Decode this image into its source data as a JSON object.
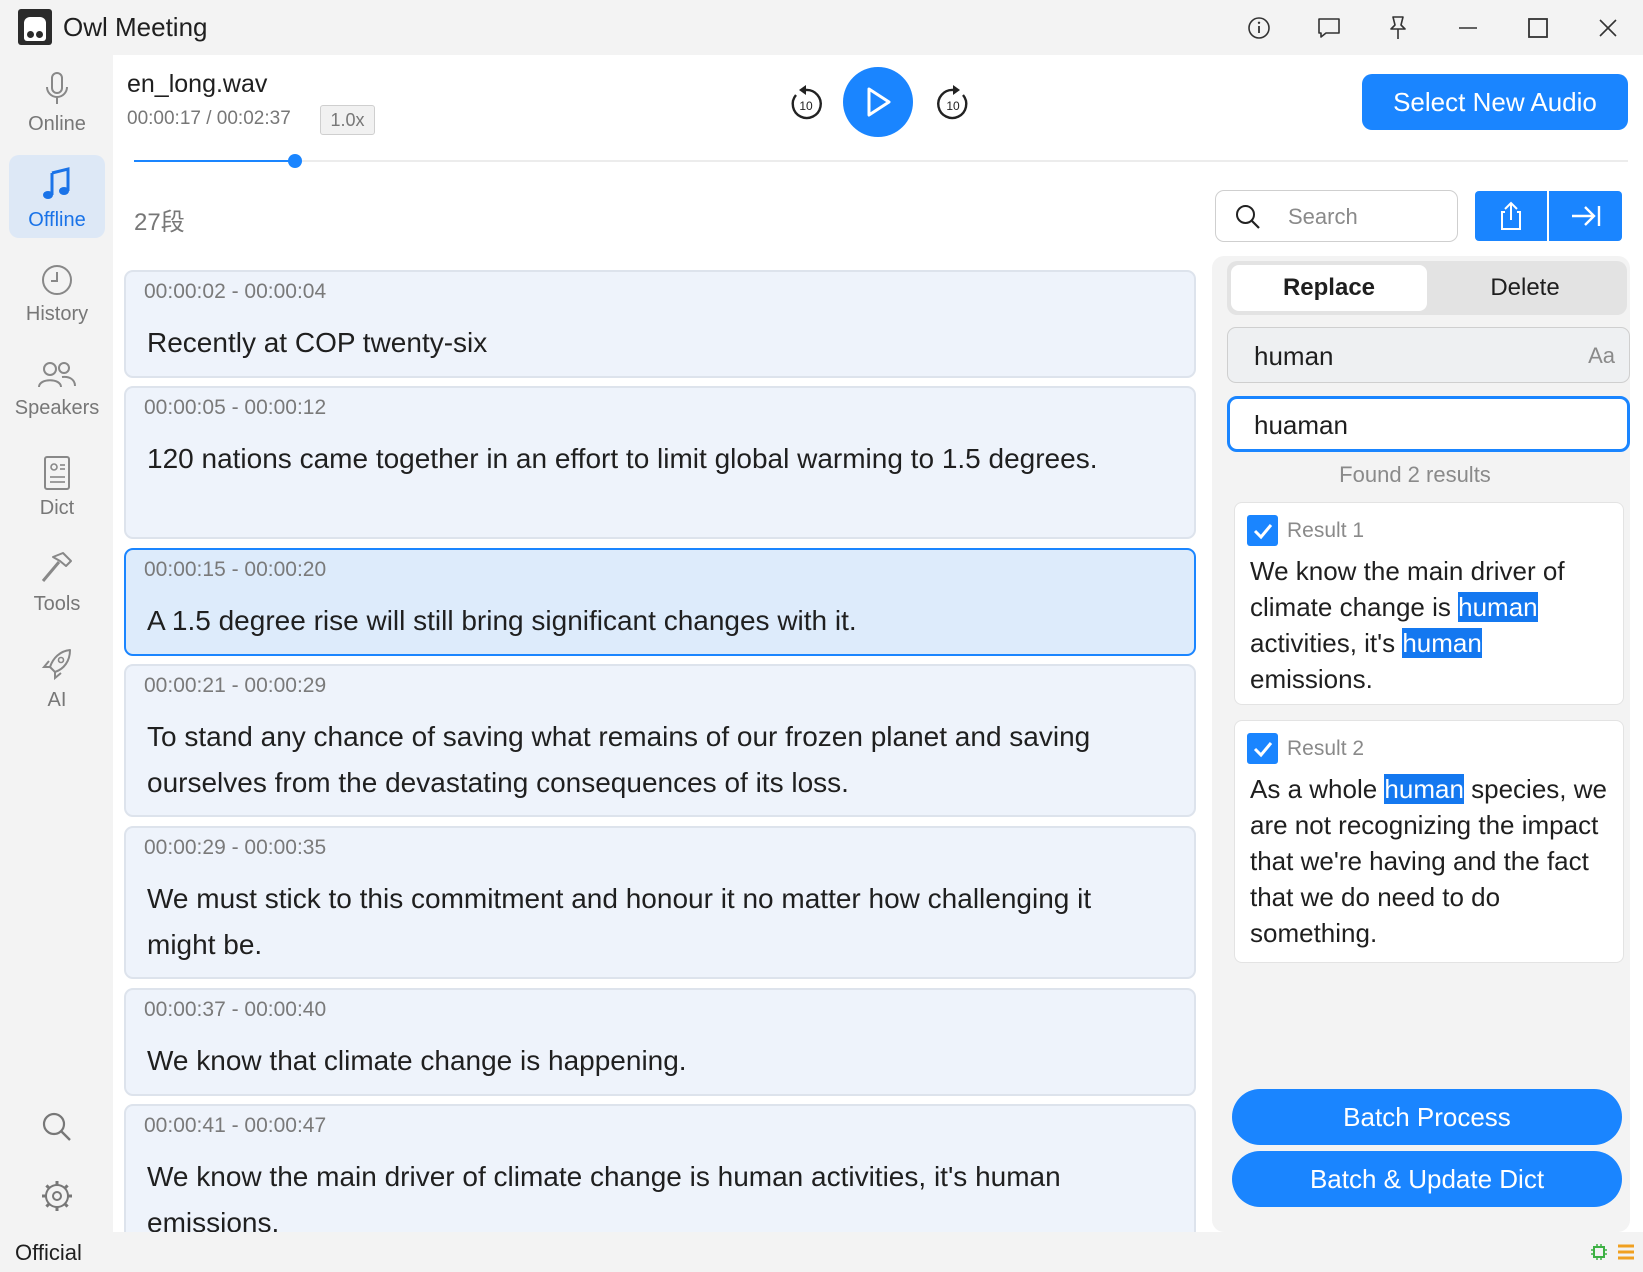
{
  "window": {
    "title": "Owl Meeting",
    "icons": [
      "info-icon",
      "feedback-icon",
      "pin-icon",
      "minimize-icon",
      "maximize-icon",
      "close-icon"
    ]
  },
  "nav": {
    "items": [
      {
        "label": "Online",
        "icon": "microphone-icon",
        "active": false
      },
      {
        "label": "Offline",
        "icon": "music-note-icon",
        "active": true
      },
      {
        "label": "History",
        "icon": "clock-icon",
        "active": false
      },
      {
        "label": "Speakers",
        "icon": "people-icon",
        "active": false
      },
      {
        "label": "Dict",
        "icon": "dictionary-icon",
        "active": false
      },
      {
        "label": "Tools",
        "icon": "hammer-icon",
        "active": false
      },
      {
        "label": "AI",
        "icon": "rocket-icon",
        "active": false
      }
    ]
  },
  "player": {
    "filename": "en_long.wav",
    "time": "00:00:17 / 00:02:37",
    "speed": "1.0x",
    "skip_back": "10",
    "skip_forward": "10",
    "progress_fraction": 0.108,
    "select_label": "Select New Audio"
  },
  "transcript": {
    "count_label": "27段",
    "segments": [
      {
        "time": "00:00:02 - 00:00:04",
        "text": "Recently at COP twenty-six",
        "active": false
      },
      {
        "time": "00:00:05 - 00:00:12",
        "text": "120 nations came together in an effort to limit global warming to 1.5 degrees.",
        "active": false
      },
      {
        "time": "00:00:15 - 00:00:20",
        "text": "A 1.5 degree rise will still bring significant changes with it.",
        "active": true
      },
      {
        "time": "00:00:21 - 00:00:29",
        "text": "To stand any chance of saving what remains of our frozen planet and saving ourselves from the devastating consequences of its loss.",
        "active": false
      },
      {
        "time": "00:00:29 - 00:00:35",
        "text": "We must stick to this commitment and honour it no matter how challenging it might be.",
        "active": false
      },
      {
        "time": "00:00:37 - 00:00:40",
        "text": "We know that climate change is happening.",
        "active": false
      },
      {
        "time": "00:00:41 - 00:00:47",
        "text": "We know the main driver of climate change is human activities, it's human emissions.",
        "active": false
      }
    ]
  },
  "search": {
    "placeholder": "Search"
  },
  "replace_panel": {
    "tabs": [
      "Replace",
      "Delete"
    ],
    "selected_tab": "Replace",
    "find_value": "human",
    "match_case_label": "Aa",
    "replace_value": "huaman",
    "found_text": "Found 2 results",
    "results": [
      {
        "title": "Result 1",
        "checked": true,
        "parts": [
          {
            "t": "We know the main driver of climate change is ",
            "h": false
          },
          {
            "t": "human",
            "h": true
          },
          {
            "t": " activities, it's ",
            "h": false
          },
          {
            "t": "human",
            "h": true
          },
          {
            "t": " emissions.",
            "h": false
          }
        ]
      },
      {
        "title": "Result 2",
        "checked": true,
        "parts": [
          {
            "t": "As a whole ",
            "h": false
          },
          {
            "t": "human",
            "h": true
          },
          {
            "t": " species, we are not recognizing the impact that we're having and the fact that we do need to do something.",
            "h": false
          }
        ]
      }
    ],
    "batch_process_label": "Batch Process",
    "batch_update_label": "Batch & Update Dict"
  },
  "status": {
    "text": "Official"
  },
  "colors": {
    "accent": "#1a85ff",
    "highlight": "#1478f0",
    "sidebar_bg": "#f3f3f3",
    "segment_bg": "#eef3fb",
    "active_segment_bg": "#ddebfb"
  }
}
